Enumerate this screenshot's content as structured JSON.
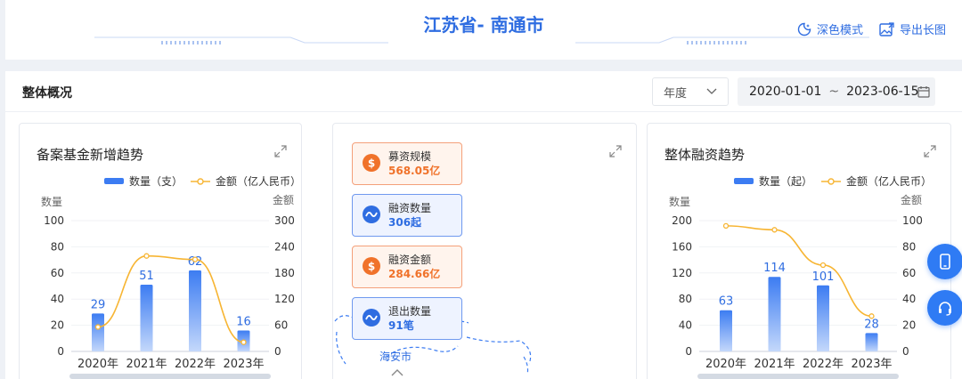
{
  "header": {
    "title": "江苏省- 南通市",
    "dark_mode_label": "深色模式",
    "export_label": "导出长图"
  },
  "overview": {
    "title": "整体概况",
    "period_select": "年度",
    "date_start": "2020-01-01",
    "date_sep": "~",
    "date_end": "2023-06-15"
  },
  "center_card": {
    "metrics": [
      {
        "label": "募资规模",
        "value": "568.05亿",
        "icon": "dollar-icon",
        "tone": "orange"
      },
      {
        "label": "融资数量",
        "value": "306起",
        "icon": "chart-icon",
        "tone": "blue"
      },
      {
        "label": "融资金额",
        "value": "284.66亿",
        "icon": "dollar-icon",
        "tone": "orange"
      },
      {
        "label": "退出数量",
        "value": "91笔",
        "icon": "chart-icon",
        "tone": "blue"
      }
    ],
    "map_label": "海安市"
  },
  "colors": {
    "accent": "#2f6de1",
    "bar": "#3c7cf2",
    "line": "#f7b533",
    "orange": "#f0722a"
  },
  "chart_data": [
    {
      "type": "bar",
      "title": "备案基金新增趋势",
      "categories": [
        "2020年",
        "2021年",
        "2022年",
        "2023年"
      ],
      "legend": [
        "数量（支）",
        "金额（亿人民币）"
      ],
      "left_axis_label": "数量",
      "right_axis_label": "金额",
      "left_ticks": [
        "100",
        "80",
        "60",
        "40",
        "20",
        "0"
      ],
      "right_ticks": [
        "300",
        "240",
        "180",
        "120",
        "60",
        "0"
      ],
      "ylim": [
        0,
        100
      ],
      "y2lim": [
        0,
        300
      ],
      "series": [
        {
          "name": "数量（支）",
          "type": "bar",
          "values": [
            29,
            51,
            62,
            16
          ]
        },
        {
          "name": "金额（亿人民币）",
          "type": "line",
          "values": [
            56,
            219,
            211,
            21
          ]
        }
      ]
    },
    {
      "type": "bar",
      "title": "整体融资趋势",
      "categories": [
        "2020年",
        "2021年",
        "2022年",
        "2023年"
      ],
      "legend": [
        "数量（起）",
        "金额（亿人民币）"
      ],
      "left_axis_label": "数量",
      "right_axis_label": "金额",
      "left_ticks": [
        "200",
        "160",
        "120",
        "80",
        "40",
        "0"
      ],
      "right_ticks": [
        "100",
        "80",
        "60",
        "40",
        "20",
        "0"
      ],
      "ylim": [
        0,
        200
      ],
      "y2lim": [
        0,
        100
      ],
      "series": [
        {
          "name": "数量（起）",
          "type": "bar",
          "values": [
            63,
            114,
            101,
            28
          ]
        },
        {
          "name": "金额（亿人民币）",
          "type": "line",
          "values": [
            96,
            93,
            66,
            27
          ]
        }
      ]
    }
  ]
}
